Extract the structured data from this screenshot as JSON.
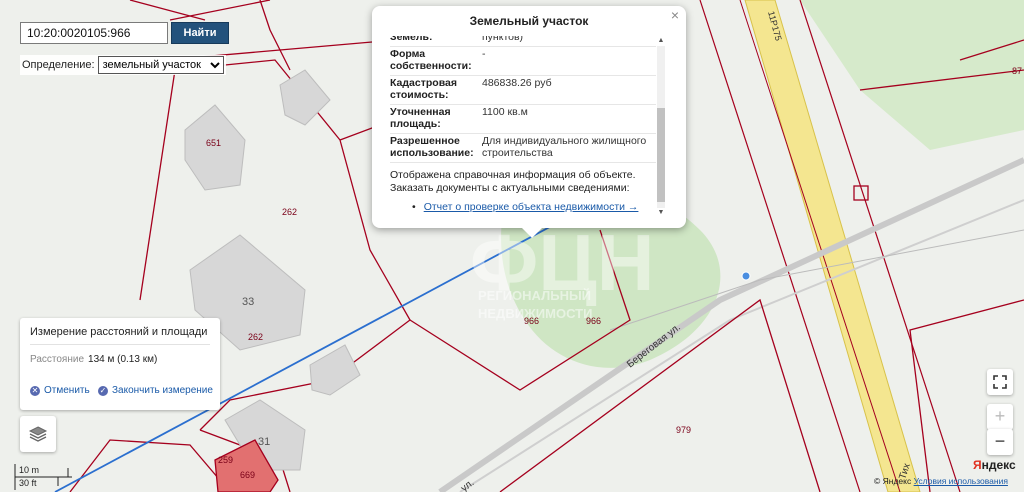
{
  "search": {
    "value": "10:20:0020105:966",
    "button_label": "Найти"
  },
  "definition": {
    "label": "Определение:",
    "selected": "земельный участок"
  },
  "popup": {
    "title": "Земельный участок",
    "close_glyph": "×",
    "rows": [
      {
        "key": "Земель:",
        "value": "пунктов)"
      },
      {
        "key": "Форма собственности:",
        "value": "-"
      },
      {
        "key": "Кадастровая стоимость:",
        "value": "486838.26 руб"
      },
      {
        "key": "Уточненная площадь:",
        "value": "1100 кв.м"
      },
      {
        "key": "Разрешенное использование:",
        "value": "Для индивидуального жилищного строительства"
      }
    ],
    "note": "Отображена справочная информация об объекте. Заказать документы с актуальными сведениями:",
    "link": "Отчет о проверке объекта недвижимости →"
  },
  "measure": {
    "title": "Измерение расстояний и площади",
    "distance_label": "Расстояние",
    "distance_value": "134 м (0.13 км)",
    "cancel_label": "Отменить",
    "finish_label": "Закончить измерение"
  },
  "map_labels": {
    "parcel_651": "651",
    "parcel_262_a": "262",
    "parcel_33": "33",
    "parcel_262_b": "262",
    "parcel_31": "31",
    "parcel_259": "259",
    "parcel_669": "669",
    "parcel_966_a": "966",
    "parcel_966_b": "966",
    "parcel_979": "979",
    "parcel_87": "87",
    "street_beregovaya": "Береговая ул.",
    "street_ul": "ул.",
    "street_tikh": "Тих",
    "road_code": "11Р175",
    "watermark_big": "ФЦН",
    "watermark_sub1": "РЕГИОНАЛЬНЫЙ",
    "watermark_sub2": "НЕДВИЖИМОСТИ"
  },
  "scale": {
    "metric": "10 m",
    "imperial": "30 ft"
  },
  "controls": {
    "zoom_in": "+",
    "zoom_out": "−"
  },
  "copyright": {
    "prefix": "© Яндекс",
    "terms": "Условия использования"
  },
  "logo": {
    "first": "Я",
    "rest": "ндекс"
  },
  "colors": {
    "parcel_border": "#a5001e",
    "road_yellow": "#f2e27a",
    "measure_line": "#2b6fcf",
    "selected_parcel": "#e06c6c",
    "green_area": "#d4e9cc"
  }
}
